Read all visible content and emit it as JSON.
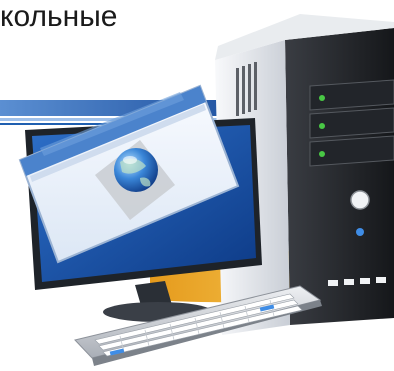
{
  "slide": {
    "caption_fragment": "кольные"
  },
  "colors": {
    "banner_blue": "#1f5fb0",
    "accent_gold": "#e8a020",
    "tower_light": "#f2f4f6",
    "tower_dark": "#2a2c30",
    "led_green": "#49c845",
    "led_blue": "#3f8de6"
  },
  "icons": [
    "computer-tower-illustration",
    "monitor-illustration",
    "browser-window-illustration",
    "globe-icon",
    "keyboard-illustration"
  ]
}
